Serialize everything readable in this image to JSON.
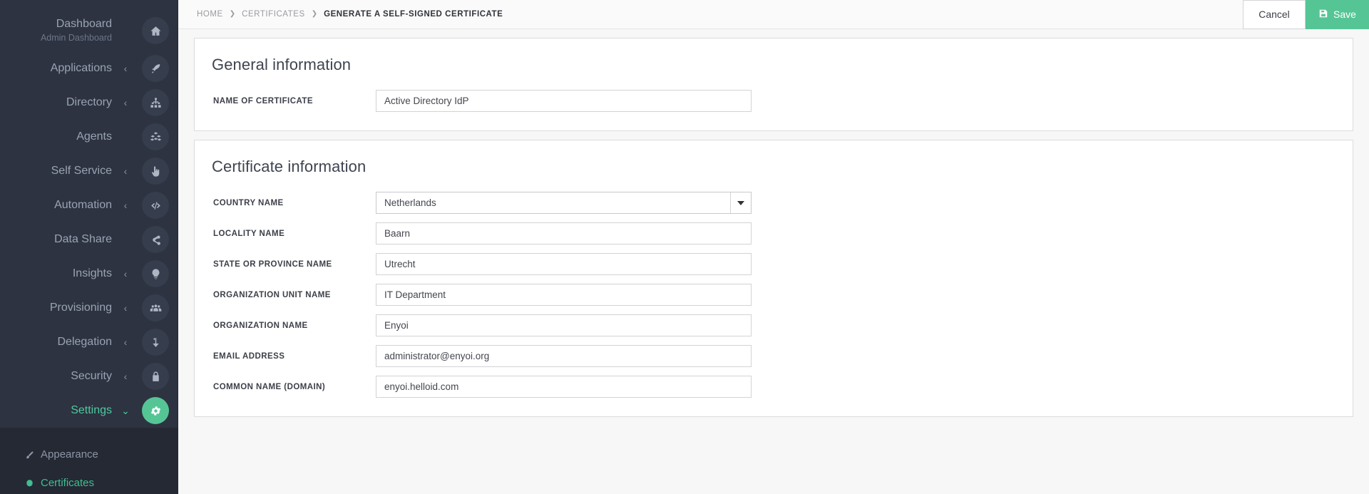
{
  "sidebar": {
    "items": [
      {
        "label": "Dashboard",
        "sublabel": "Admin Dashboard",
        "icon": "home-icon",
        "caret": "",
        "active": false
      },
      {
        "label": "Applications",
        "sublabel": "",
        "icon": "rocket-icon",
        "caret": "‹",
        "active": false
      },
      {
        "label": "Directory",
        "sublabel": "",
        "icon": "sitemap-icon",
        "caret": "‹",
        "active": false
      },
      {
        "label": "Agents",
        "sublabel": "",
        "icon": "cubes-icon",
        "caret": "",
        "active": false
      },
      {
        "label": "Self Service",
        "sublabel": "",
        "icon": "hand-pointer-icon",
        "caret": "‹",
        "active": false
      },
      {
        "label": "Automation",
        "sublabel": "",
        "icon": "code-icon",
        "caret": "‹",
        "active": false
      },
      {
        "label": "Data Share",
        "sublabel": "",
        "icon": "share-icon",
        "caret": "",
        "active": false
      },
      {
        "label": "Insights",
        "sublabel": "",
        "icon": "lightbulb-icon",
        "caret": "‹",
        "active": false
      },
      {
        "label": "Provisioning",
        "sublabel": "",
        "icon": "users-icon",
        "caret": "‹",
        "active": false
      },
      {
        "label": "Delegation",
        "sublabel": "",
        "icon": "arrow-turn-down-icon",
        "caret": "‹",
        "active": false
      },
      {
        "label": "Security",
        "sublabel": "",
        "icon": "lock-icon",
        "caret": "‹",
        "active": false
      },
      {
        "label": "Settings",
        "sublabel": "",
        "icon": "gear-icon",
        "caret": "⌄",
        "active": true
      }
    ],
    "submenu": [
      {
        "label": "Appearance",
        "icon": "paintbrush-icon",
        "active": false
      },
      {
        "label": "Certificates",
        "icon": "certificate-icon",
        "active": true
      }
    ]
  },
  "topbar": {
    "breadcrumb": [
      {
        "label": "Home",
        "current": false
      },
      {
        "label": "Certificates",
        "current": false
      },
      {
        "label": "Generate a self-signed certificate",
        "current": true
      }
    ],
    "separator": "❯",
    "cancel_label": "Cancel",
    "save_label": "Save",
    "save_icon": "save-icon"
  },
  "general": {
    "title": "General information",
    "fields": [
      {
        "label": "Name of certificate",
        "value": "Active Directory IdP",
        "type": "text"
      }
    ]
  },
  "certificate": {
    "title": "Certificate information",
    "fields": [
      {
        "label": "Country name",
        "value": "Netherlands",
        "type": "select"
      },
      {
        "label": "Locality name",
        "value": "Baarn",
        "type": "text"
      },
      {
        "label": "State or province name",
        "value": "Utrecht",
        "type": "text"
      },
      {
        "label": "Organization unit name",
        "value": "IT Department",
        "type": "text"
      },
      {
        "label": "Organization name",
        "value": "Enyoi",
        "type": "text"
      },
      {
        "label": "Email address",
        "value": "administrator@enyoi.org",
        "type": "text"
      },
      {
        "label": "Common name (domain)",
        "value": "enyoi.helloid.com",
        "type": "text"
      }
    ]
  },
  "colors": {
    "accent": "#56c596",
    "sidebar_bg": "#2d3340",
    "submenu_bg": "#242934",
    "page_bg": "#f7f7f8"
  }
}
